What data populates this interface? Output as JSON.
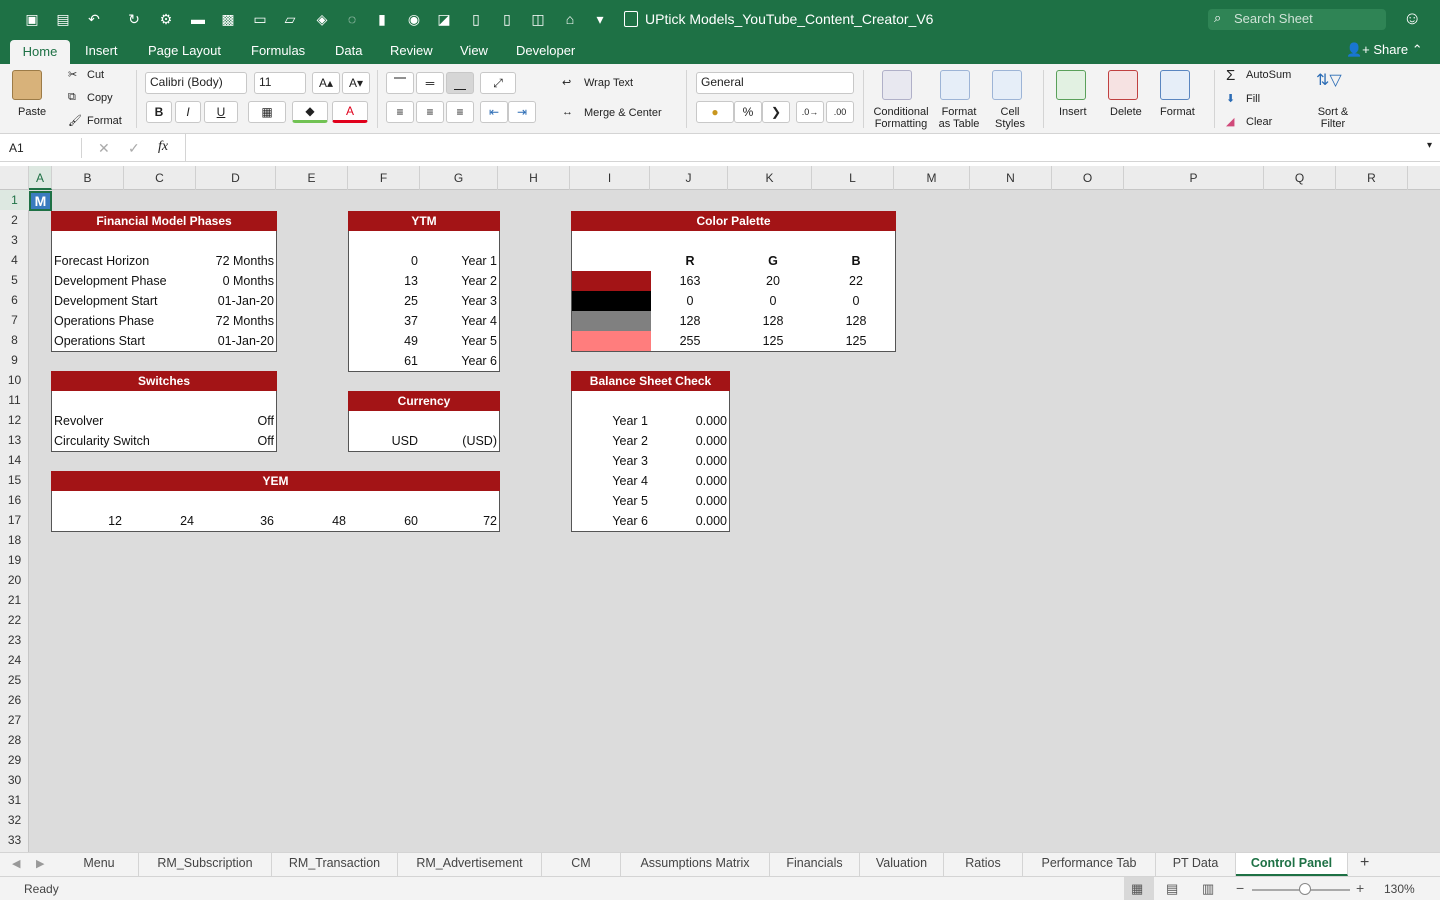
{
  "window": {
    "title": "UPtick Models_YouTube_Content_Creator_V6",
    "search_placeholder": "Search Sheet"
  },
  "ribbon_tabs": [
    "Home",
    "Insert",
    "Page Layout",
    "Formulas",
    "Data",
    "Review",
    "View",
    "Developer"
  ],
  "share_label": "Share",
  "clipboard": {
    "paste": "Paste",
    "cut": "Cut",
    "copy": "Copy",
    "format": "Format"
  },
  "font": {
    "name": "Calibri (Body)",
    "size": "11",
    "bold": "B",
    "italic": "I",
    "underline": "U"
  },
  "alignment": {
    "wrap_text": "Wrap Text",
    "merge_center": "Merge & Center"
  },
  "number": {
    "format": "General",
    "percent": "%"
  },
  "styles": {
    "conditional": "Conditional",
    "formatting": "Formatting",
    "format_as": "Format",
    "as_table": "as Table",
    "cell": "Cell",
    "cell_styles": "Styles"
  },
  "cells": {
    "insert": "Insert",
    "delete": "Delete",
    "format": "Format"
  },
  "editing": {
    "autosum": "AutoSum",
    "fill": "Fill",
    "clear": "Clear",
    "sort": "Sort &",
    "filter": "Filter"
  },
  "formula_bar": {
    "name_box": "A1",
    "fx": "fx",
    "value": ""
  },
  "columns": [
    "A",
    "B",
    "C",
    "D",
    "E",
    "F",
    "G",
    "H",
    "I",
    "J",
    "K",
    "L",
    "M",
    "N",
    "O",
    "P",
    "Q",
    "R"
  ],
  "rows": [
    "1",
    "2",
    "3",
    "4",
    "5",
    "6",
    "7",
    "8",
    "9",
    "10",
    "11",
    "12",
    "13",
    "14",
    "15",
    "16",
    "17",
    "18",
    "19",
    "20",
    "21",
    "22",
    "23",
    "24",
    "25",
    "26",
    "27",
    "28",
    "29",
    "30",
    "31",
    "32",
    "33"
  ],
  "a1_value": "M",
  "phases": {
    "title": "Financial Model Phases",
    "rows": [
      {
        "label": "Forecast Horizon",
        "value": "72 Months"
      },
      {
        "label": "Development Phase",
        "value": "0 Months"
      },
      {
        "label": "Development Start",
        "value": "01-Jan-20"
      },
      {
        "label": "Operations Phase",
        "value": "72 Months"
      },
      {
        "label": "Operations Start",
        "value": "01-Jan-20"
      }
    ]
  },
  "ytm": {
    "title": "YTM",
    "rows": [
      {
        "n": "0",
        "label": "Year 1"
      },
      {
        "n": "13",
        "label": "Year 2"
      },
      {
        "n": "25",
        "label": "Year 3"
      },
      {
        "n": "37",
        "label": "Year 4"
      },
      {
        "n": "49",
        "label": "Year 5"
      },
      {
        "n": "61",
        "label": "Year 6"
      }
    ]
  },
  "palette": {
    "title": "Color Palette",
    "headers": [
      "R",
      "G",
      "B"
    ],
    "rows": [
      {
        "swatch": "#a31416",
        "r": "163",
        "g": "20",
        "b": "22"
      },
      {
        "swatch": "#000000",
        "r": "0",
        "g": "0",
        "b": "0"
      },
      {
        "swatch": "#808080",
        "r": "128",
        "g": "128",
        "b": "128"
      },
      {
        "swatch": "#ff7d7d",
        "r": "255",
        "g": "125",
        "b": "125"
      }
    ]
  },
  "switches": {
    "title": "Switches",
    "rows": [
      {
        "label": "Revolver",
        "value": "Off"
      },
      {
        "label": "Circularity Switch",
        "value": "Off"
      }
    ]
  },
  "currency": {
    "title": "Currency",
    "code": "USD",
    "display": "(USD)"
  },
  "yem": {
    "title": "YEM",
    "values": [
      "12",
      "24",
      "36",
      "48",
      "60",
      "72"
    ]
  },
  "balance_check": {
    "title": "Balance Sheet Check",
    "rows": [
      {
        "label": "Year 1",
        "value": "0.000"
      },
      {
        "label": "Year 2",
        "value": "0.000"
      },
      {
        "label": "Year 3",
        "value": "0.000"
      },
      {
        "label": "Year 4",
        "value": "0.000"
      },
      {
        "label": "Year 5",
        "value": "0.000"
      },
      {
        "label": "Year 6",
        "value": "0.000"
      }
    ]
  },
  "sheet_tabs": [
    "Menu",
    "RM_Subscription",
    "RM_Transaction",
    "RM_Advertisement",
    "CM",
    "Assumptions Matrix",
    "Financials",
    "Valuation",
    "Ratios",
    "Performance Tab",
    "PT Data",
    "Control Panel"
  ],
  "active_sheet": "Control Panel",
  "status": {
    "ready": "Ready",
    "zoom": "130%"
  },
  "colors": {
    "brand_green": "#1e7145",
    "header_red": "#a31416"
  }
}
